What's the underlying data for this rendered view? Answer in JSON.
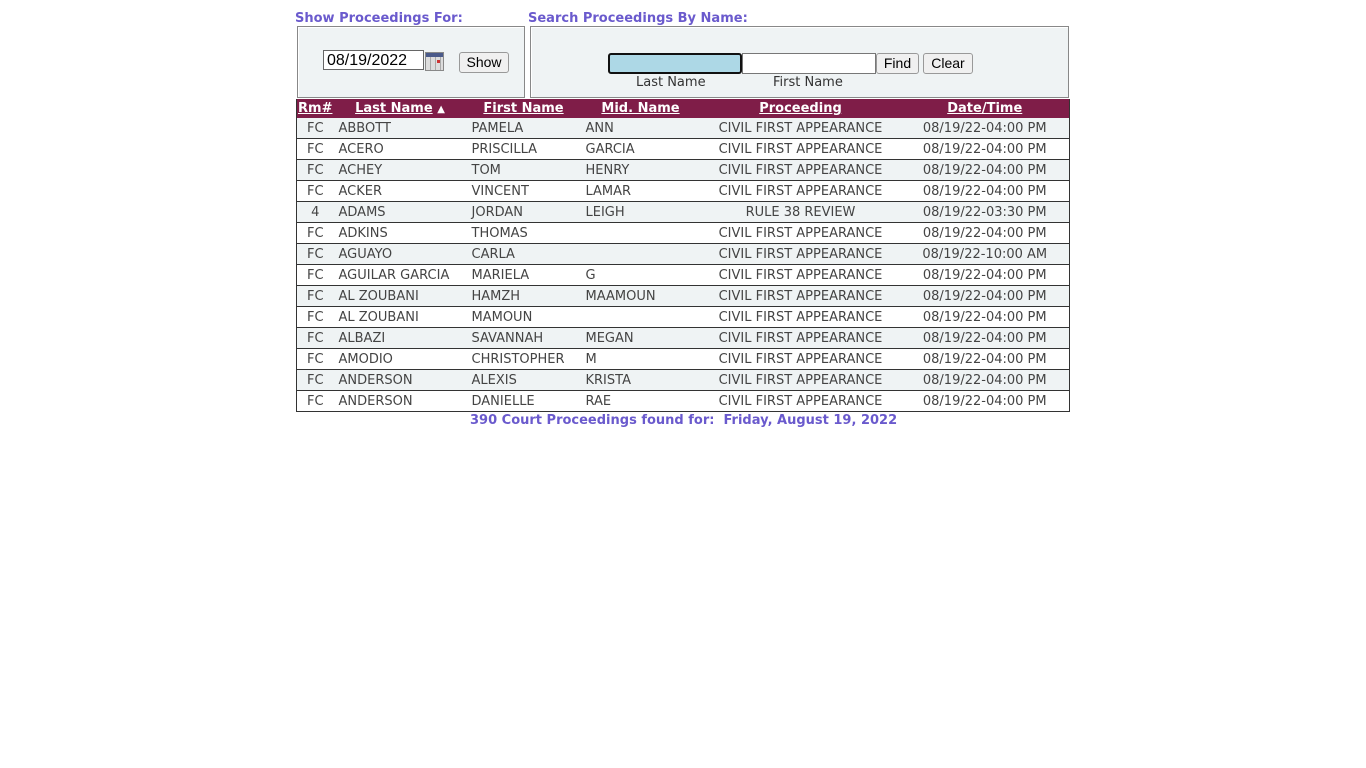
{
  "show_section": {
    "label": "Show Proceedings For:",
    "date_value": "08/19/2022",
    "show_button": "Show"
  },
  "search_section": {
    "label": "Search Proceedings By Name:",
    "last_name_value": "",
    "first_name_value": "",
    "last_name_label": "Last Name",
    "first_name_label": "First Name",
    "find_button": "Find",
    "clear_button": "Clear"
  },
  "table": {
    "headers": [
      "Rm#",
      "Last Name",
      "First Name",
      "Mid. Name",
      "Proceeding",
      "Date/Time"
    ],
    "sort_indicator": "▲",
    "rows": [
      [
        "FC",
        "ABBOTT",
        "PAMELA",
        "ANN",
        "CIVIL FIRST APPEARANCE",
        "08/19/22-04:00 PM"
      ],
      [
        "FC",
        "ACERO",
        "PRISCILLA",
        "GARCIA",
        "CIVIL FIRST APPEARANCE",
        "08/19/22-04:00 PM"
      ],
      [
        "FC",
        "ACHEY",
        "TOM",
        "HENRY",
        "CIVIL FIRST APPEARANCE",
        "08/19/22-04:00 PM"
      ],
      [
        "FC",
        "ACKER",
        "VINCENT",
        "LAMAR",
        "CIVIL FIRST APPEARANCE",
        "08/19/22-04:00 PM"
      ],
      [
        "4",
        "ADAMS",
        "JORDAN",
        "LEIGH",
        "RULE 38 REVIEW",
        "08/19/22-03:30 PM"
      ],
      [
        "FC",
        "ADKINS",
        "THOMAS",
        "",
        "CIVIL FIRST APPEARANCE",
        "08/19/22-04:00 PM"
      ],
      [
        "FC",
        "AGUAYO",
        "CARLA",
        "",
        "CIVIL FIRST APPEARANCE",
        "08/19/22-10:00 AM"
      ],
      [
        "FC",
        "AGUILAR GARCIA",
        "MARIELA",
        "G",
        "CIVIL FIRST APPEARANCE",
        "08/19/22-04:00 PM"
      ],
      [
        "FC",
        "AL ZOUBANI",
        "HAMZH",
        "MAAMOUN",
        "CIVIL FIRST APPEARANCE",
        "08/19/22-04:00 PM"
      ],
      [
        "FC",
        "AL ZOUBANI",
        "MAMOUN",
        "",
        "CIVIL FIRST APPEARANCE",
        "08/19/22-04:00 PM"
      ],
      [
        "FC",
        "ALBAZI",
        "SAVANNAH",
        "MEGAN",
        "CIVIL FIRST APPEARANCE",
        "08/19/22-04:00 PM"
      ],
      [
        "FC",
        "AMODIO",
        "CHRISTOPHER",
        "M",
        "CIVIL FIRST APPEARANCE",
        "08/19/22-04:00 PM"
      ],
      [
        "FC",
        "ANDERSON",
        "ALEXIS",
        "KRISTA",
        "CIVIL FIRST APPEARANCE",
        "08/19/22-04:00 PM"
      ],
      [
        "FC",
        "ANDERSON",
        "DANIELLE",
        "RAE",
        "CIVIL FIRST APPEARANCE",
        "08/19/22-04:00 PM"
      ]
    ]
  },
  "footer": "390 Court Proceedings found for:  Friday, August 19, 2022",
  "colors": {
    "header_bg": "#7f1d48",
    "label": "#6a5acd",
    "row_alt": "#eff3f4",
    "search_focus": "#add8e6"
  }
}
